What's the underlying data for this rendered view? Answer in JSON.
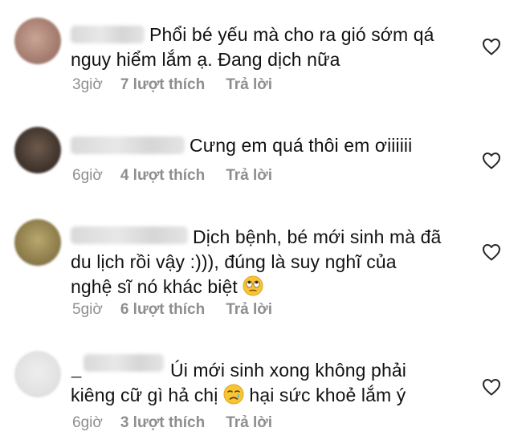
{
  "comments": [
    {
      "text_line1": "Phổi bé yếu mà cho ra gió sớm qá",
      "text_line2": "nguy hiểm lắm ạ. Đang dịch nữa",
      "time": "3giờ",
      "likes": "7 lượt thích",
      "reply": "Trả lời",
      "avatar_color": "#b99484"
    },
    {
      "text_line1": "Cưng em quá thôi em ơiiiiii",
      "time": "6giờ",
      "likes": "4 lượt thích",
      "reply": "Trả lời",
      "avatar_color": "#5a4a3f"
    },
    {
      "text_line1": "Dịch bệnh, bé mới sinh mà đã",
      "text_line2": "du lịch rồi vậy :))), đúng là suy nghĩ của",
      "text_line3": "nghệ sĩ nó khác biệt",
      "emoji": "eye-roll-emoji",
      "time": "5giờ",
      "likes": "6 lượt thích",
      "reply": "Trả lời",
      "avatar_color": "#9c8a56"
    },
    {
      "name_prefix": "_",
      "text_line1": "Úi mới sinh xong không phải",
      "text_line2_a": "kiêng cữ gì hả chị",
      "text_line2_b": "hại sức khoẻ lắm ý",
      "emoji": "crying-face-emoji",
      "time": "6giờ",
      "likes": "3 lượt thích",
      "reply": "Trả lời",
      "avatar_color": "#e4e4e4"
    }
  ],
  "icons": {
    "like": "heart-outline-icon"
  }
}
